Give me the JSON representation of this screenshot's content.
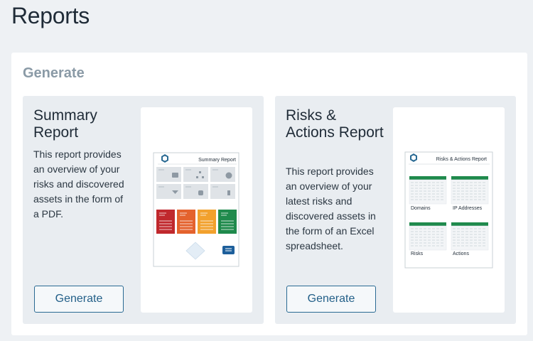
{
  "page": {
    "title": "Reports"
  },
  "panel": {
    "title": "Generate"
  },
  "cards": [
    {
      "title": "Summary Report",
      "description": "This report provides an overview of your risks and discovered assets in the form of a PDF.",
      "button_label": "Generate",
      "thumbnail": {
        "header": "Summary Report",
        "tile_colors": [
          "#c0282d",
          "#e4622d",
          "#f2a12d",
          "#1f8a4c"
        ]
      }
    },
    {
      "title": "Risks & Actions Report",
      "description": "This report provides an overview of your latest risks and discovered assets in the form of an Excel spreadsheet.",
      "button_label": "Generate",
      "thumbnail": {
        "header": "Risks & Actions Report",
        "sheets": [
          "Domains",
          "IP Addresses",
          "Risks",
          "Actions"
        ],
        "sheet_color": "#1f8a4c"
      }
    }
  ]
}
